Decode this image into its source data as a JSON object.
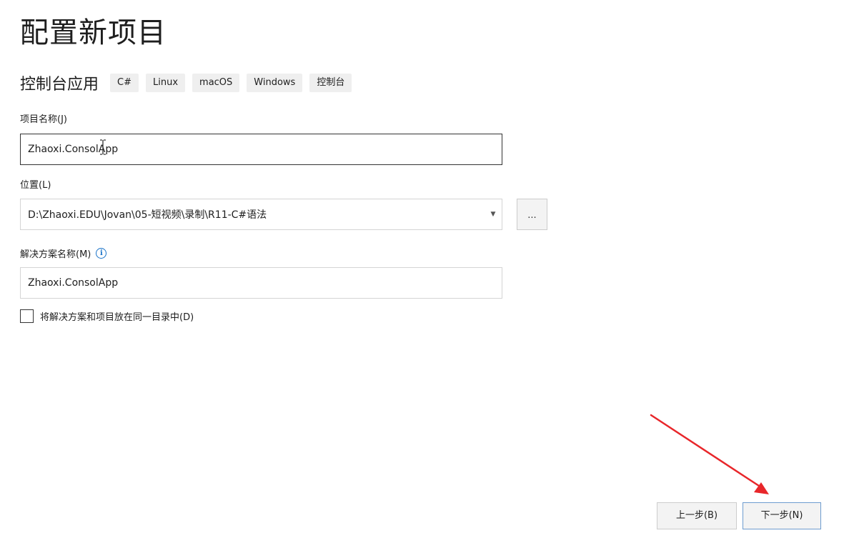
{
  "page": {
    "title": "配置新项目"
  },
  "template": {
    "name": "控制台应用",
    "tags": [
      "C#",
      "Linux",
      "macOS",
      "Windows",
      "控制台"
    ]
  },
  "project_name": {
    "label": "项目名称(J)",
    "value": "Zhaoxi.ConsolApp"
  },
  "location": {
    "label": "位置(L)",
    "value": "D:\\Zhaoxi.EDU\\Jovan\\05-短视频\\录制\\R11-C#语法",
    "browse_label": "..."
  },
  "solution_name": {
    "label": "解决方案名称(M)",
    "value": "Zhaoxi.ConsolApp",
    "info_icon": "info-icon"
  },
  "same_directory": {
    "label": "将解决方案和项目放在同一目录中(D)",
    "checked": false
  },
  "footer": {
    "back_label": "上一步(B)",
    "next_label": "下一步(N)"
  },
  "annotation": {
    "arrow_color": "#e8262a",
    "target": "next-button"
  },
  "colors": {
    "accent": "#1a73c8",
    "next_border": "#6e9ccf"
  }
}
